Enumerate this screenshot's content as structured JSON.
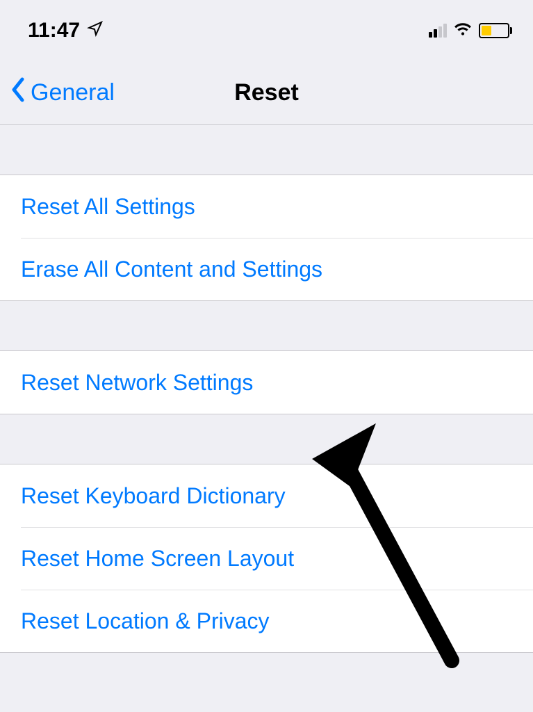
{
  "status": {
    "time": "11:47"
  },
  "nav": {
    "back_label": "General",
    "title": "Reset"
  },
  "groups": [
    {
      "items": [
        {
          "label": "Reset All Settings"
        },
        {
          "label": "Erase All Content and Settings"
        }
      ]
    },
    {
      "items": [
        {
          "label": "Reset Network Settings"
        }
      ]
    },
    {
      "items": [
        {
          "label": "Reset Keyboard Dictionary"
        },
        {
          "label": "Reset Home Screen Layout"
        },
        {
          "label": "Reset Location & Privacy"
        }
      ]
    }
  ]
}
